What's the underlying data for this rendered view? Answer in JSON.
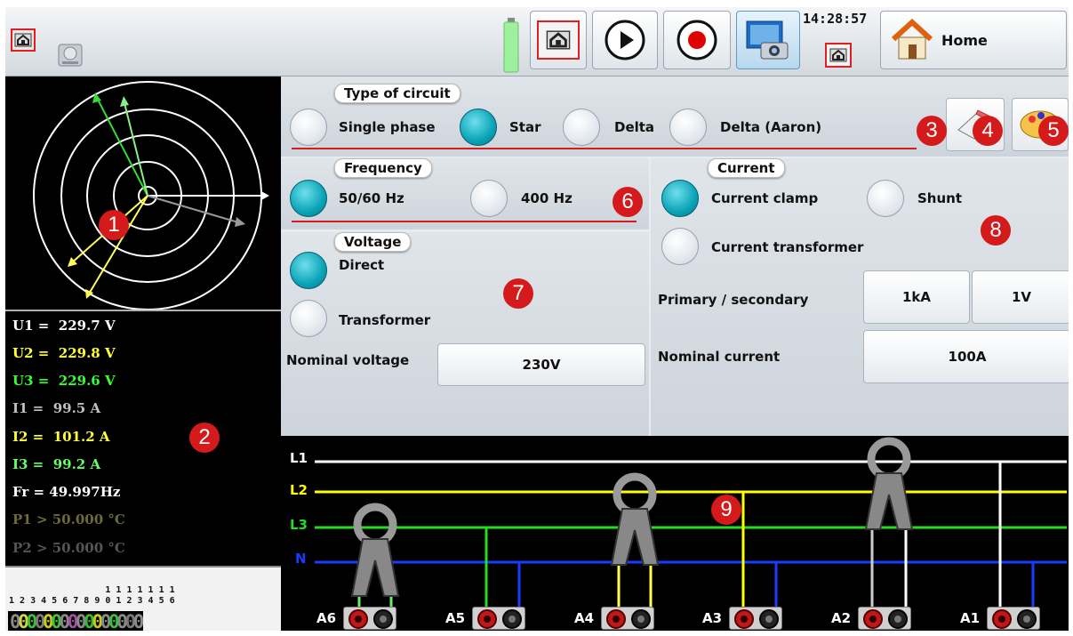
{
  "topbar": {
    "time": "14:28:57",
    "home_label": "Home",
    "icons": [
      "network-config-icon",
      "storage-drive-icon",
      "battery-icon",
      "network-config-icon",
      "play-icon",
      "record-icon",
      "camera-screenshot-icon",
      "network-config-icon",
      "home-icon"
    ]
  },
  "measures": [
    {
      "label": "U1 =  229.7 V",
      "color": "#ffffff"
    },
    {
      "label": "U2 =  229.8 V",
      "color": "#ffff33"
    },
    {
      "label": "U3 =  229.6 V",
      "color": "#33ff33"
    },
    {
      "label": "I1 =  99.5 A",
      "color": "#c0c0c0"
    },
    {
      "label": "I2 =  101.2 A",
      "color": "#ffff33"
    },
    {
      "label": "I3 =  99.2 A",
      "color": "#66ff66"
    },
    {
      "label": "Fr = 49.997Hz",
      "color": "#ffffff"
    },
    {
      "label": "P1 > 50.000 °C",
      "color": "#6b6b3a"
    },
    {
      "label": "P2 > 50.000 °C",
      "color": "#555555"
    }
  ],
  "leds": {
    "tens": "                  1 1 1 1 1 1 1",
    "units": "1 2 3 4 5 6 7 8 9 0 1 2 3 4 5 6",
    "zeros": "0000000000000000",
    "colors": [
      "#8a8a8a",
      "#d4d44a",
      "#38c038",
      "#7a7a7a",
      "#c8c820",
      "#40c040",
      "#8a8a8a",
      "#a050a0",
      "#8a8a8a",
      "#38b838",
      "#c8c820",
      "#8a8a8a",
      "#38c038",
      "#8a8a8a",
      "#7a7a7a",
      "#8a8a8a"
    ]
  },
  "circuit": {
    "title": "Type of circuit",
    "options": [
      "Single phase",
      "Star",
      "Delta",
      "Delta (Aaron)"
    ],
    "selected": "Star"
  },
  "frequency": {
    "title": "Frequency",
    "options": [
      "50/60 Hz",
      "400 Hz"
    ],
    "selected": "50/60 Hz"
  },
  "voltage": {
    "title": "Voltage",
    "options": [
      "Direct",
      "Transformer"
    ],
    "selected": "Direct",
    "nominal_label": "Nominal voltage",
    "nominal_value": "230V"
  },
  "current": {
    "title": "Current",
    "options": [
      "Current clamp",
      "Shunt",
      "Current transformer"
    ],
    "selected": "Current clamp",
    "ratio_label": "Primary / secondary",
    "primary": "1kA",
    "secondary": "1V",
    "nominal_label": "Nominal current",
    "nominal_value": "100A"
  },
  "markers": [
    "1",
    "2",
    "3",
    "4",
    "5",
    "6",
    "7",
    "8",
    "9"
  ],
  "wiring": {
    "lines": [
      {
        "label": "L1",
        "color": "#ffffff"
      },
      {
        "label": "L2",
        "color": "#ffff00"
      },
      {
        "label": "L3",
        "color": "#22dd22"
      },
      {
        "label": "N",
        "color": "#1a3cff"
      }
    ],
    "inputs": [
      "A6",
      "A5",
      "A4",
      "A3",
      "A2",
      "A1"
    ]
  }
}
